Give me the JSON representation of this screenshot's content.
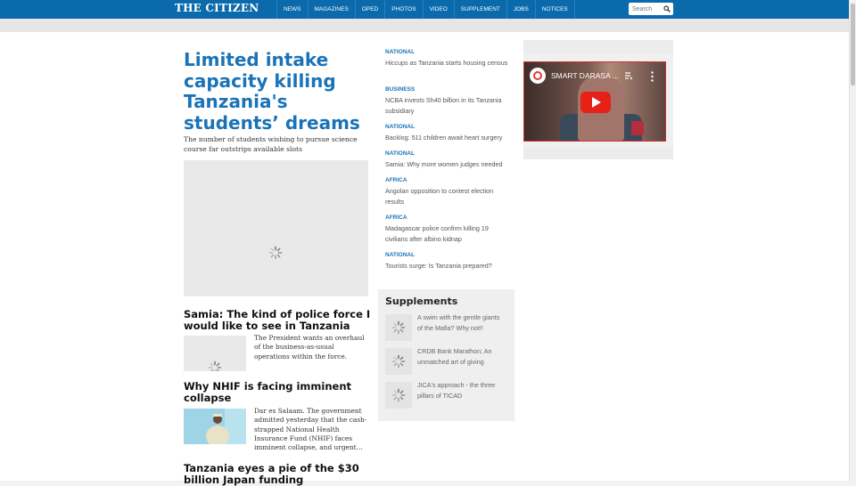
{
  "brand": {
    "logo": "THE CITIZEN"
  },
  "nav": [
    "NEWS",
    "MAGAZINES",
    "OPED",
    "PHOTOS",
    "VIDEO",
    "SUPPLEMENT",
    "JOBS",
    "NOTICES"
  ],
  "search": {
    "placeholder": "Search"
  },
  "lead": {
    "title": "Limited intake capacity killing Tanzania's students’ dreams",
    "summary": "The number of students wishing to pursue science course far outstrips available slots"
  },
  "stories": [
    {
      "title": "Samia: The kind of police force I would like to see in Tanzania",
      "summary": "The President wants an overhaul of the business-as-usual operations within the force."
    },
    {
      "title": "Why NHIF is facing imminent collapse",
      "summary": "Dar es Salaam. The government admitted yesterday that the cash-strapped National Health Insurance Fund (NHIF) faces imminent collapse, and urgent..."
    },
    {
      "title": "Tanzania eyes a pie of the $30 billion Japan funding"
    }
  ],
  "latest": [
    {
      "category": "NATIONAL",
      "title": "Hiccups as Tanzania starts housing census"
    },
    {
      "category": "BUSINESS",
      "title": "NCBA invests Sh40 billion in its Tanzania subsidiary"
    },
    {
      "category": "NATIONAL",
      "title": "Backlog: 511 children await heart surgery"
    },
    {
      "category": "NATIONAL",
      "title": "Samia: Why more women judges needed"
    },
    {
      "category": "AFRICA",
      "title": "Angolan opposition to contest election results"
    },
    {
      "category": "AFRICA",
      "title": "Madagascar police confirm killing 19 civilians after albino kidnap"
    },
    {
      "category": "NATIONAL",
      "title": "Tourists surge: Is Tanzania prepared?"
    }
  ],
  "supplements": {
    "heading": "Supplements",
    "items": [
      "A swim with the gentle giants of the Mafia? Why not!!",
      "CRDB Bank Marathon; An unmatched art of giving",
      "JICA's approach - the three pillars of TICAD"
    ]
  },
  "video": {
    "title": "SMART DARASA ..."
  },
  "colors": {
    "brand": "#0a6aab",
    "headline": "#1a73b7",
    "play": "#e62117"
  }
}
